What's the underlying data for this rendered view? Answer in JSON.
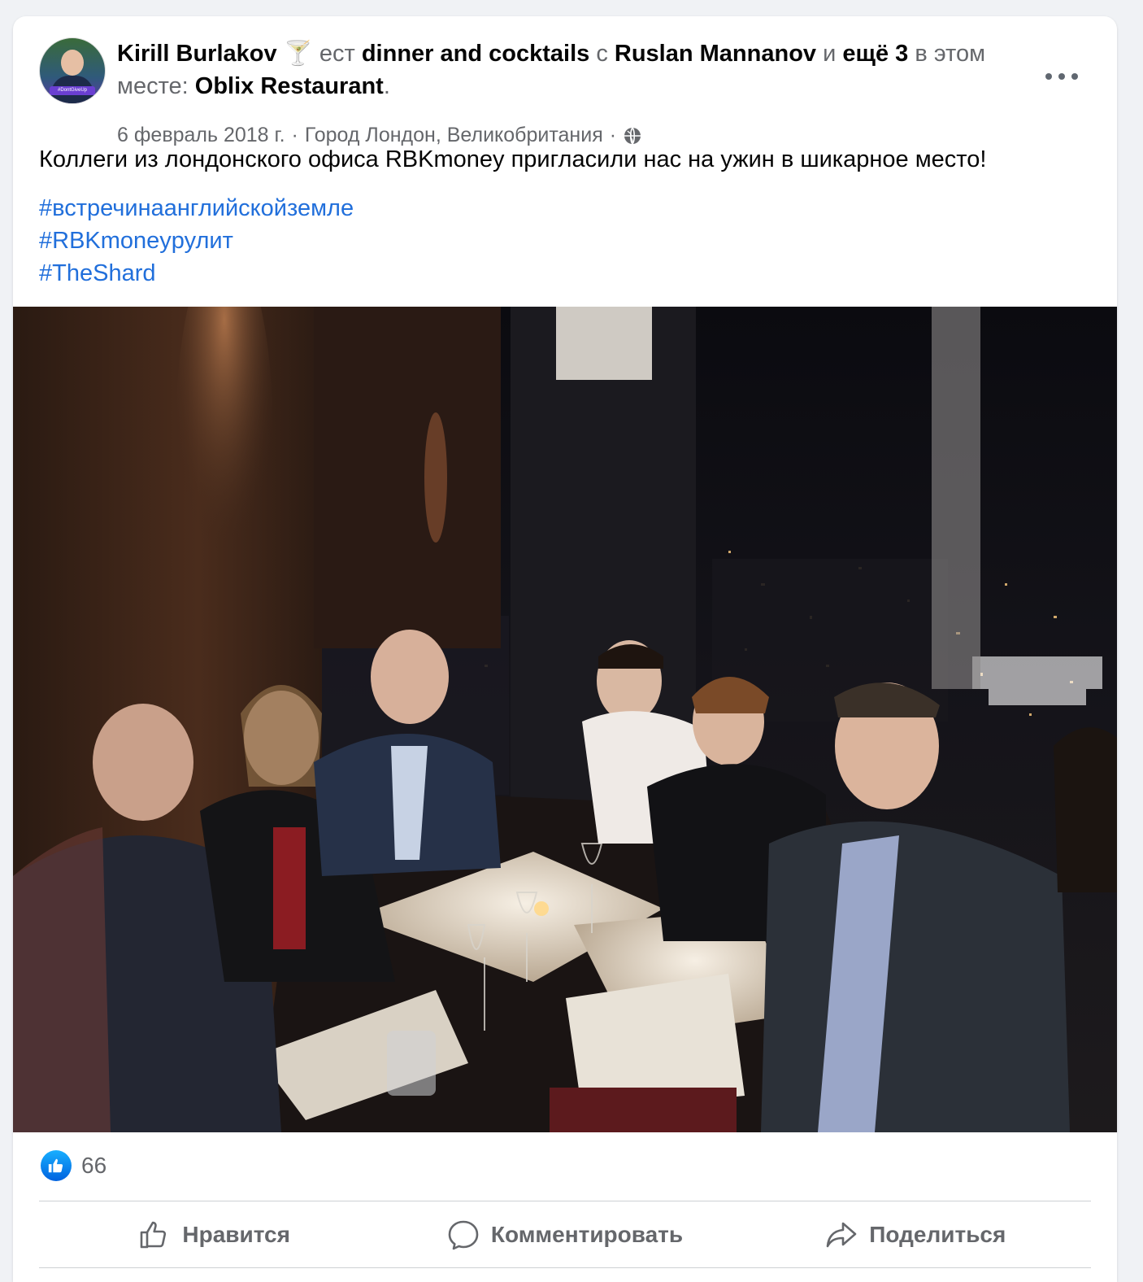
{
  "post": {
    "author": "Kirill Burlakov",
    "activity_emoji": "🍸",
    "verb": "ест",
    "activity": "dinner and cocktails",
    "with_word": "с",
    "tagged_person": "Ruslan Mannanov",
    "and_word": "и",
    "others": "ещё 3",
    "location_phrase": "в этом месте:",
    "place": "Oblix Restaurant",
    "period": ".",
    "date": "6 февраль 2018 г.",
    "separator": "·",
    "location": "Город Лондон, Великобритания",
    "audience_icon": "globe-icon",
    "text": "Коллеги из лондонского офиса RBKmoney пригласили нас на ужин в шикарное место!",
    "hashtags": [
      "#встречинаанглийскойземле",
      "#RBKmoneyрулит",
      "#TheShard"
    ],
    "avatar_badge": "#DontGiveUp"
  },
  "reactions": {
    "icon": "like-icon",
    "count": "66"
  },
  "actions": {
    "like": "Нравится",
    "comment": "Комментировать",
    "share": "Поделиться"
  },
  "colors": {
    "link": "#216fdb",
    "secondary_text": "#65676b",
    "primary_text": "#050505",
    "like_blue": "#0866ff"
  }
}
